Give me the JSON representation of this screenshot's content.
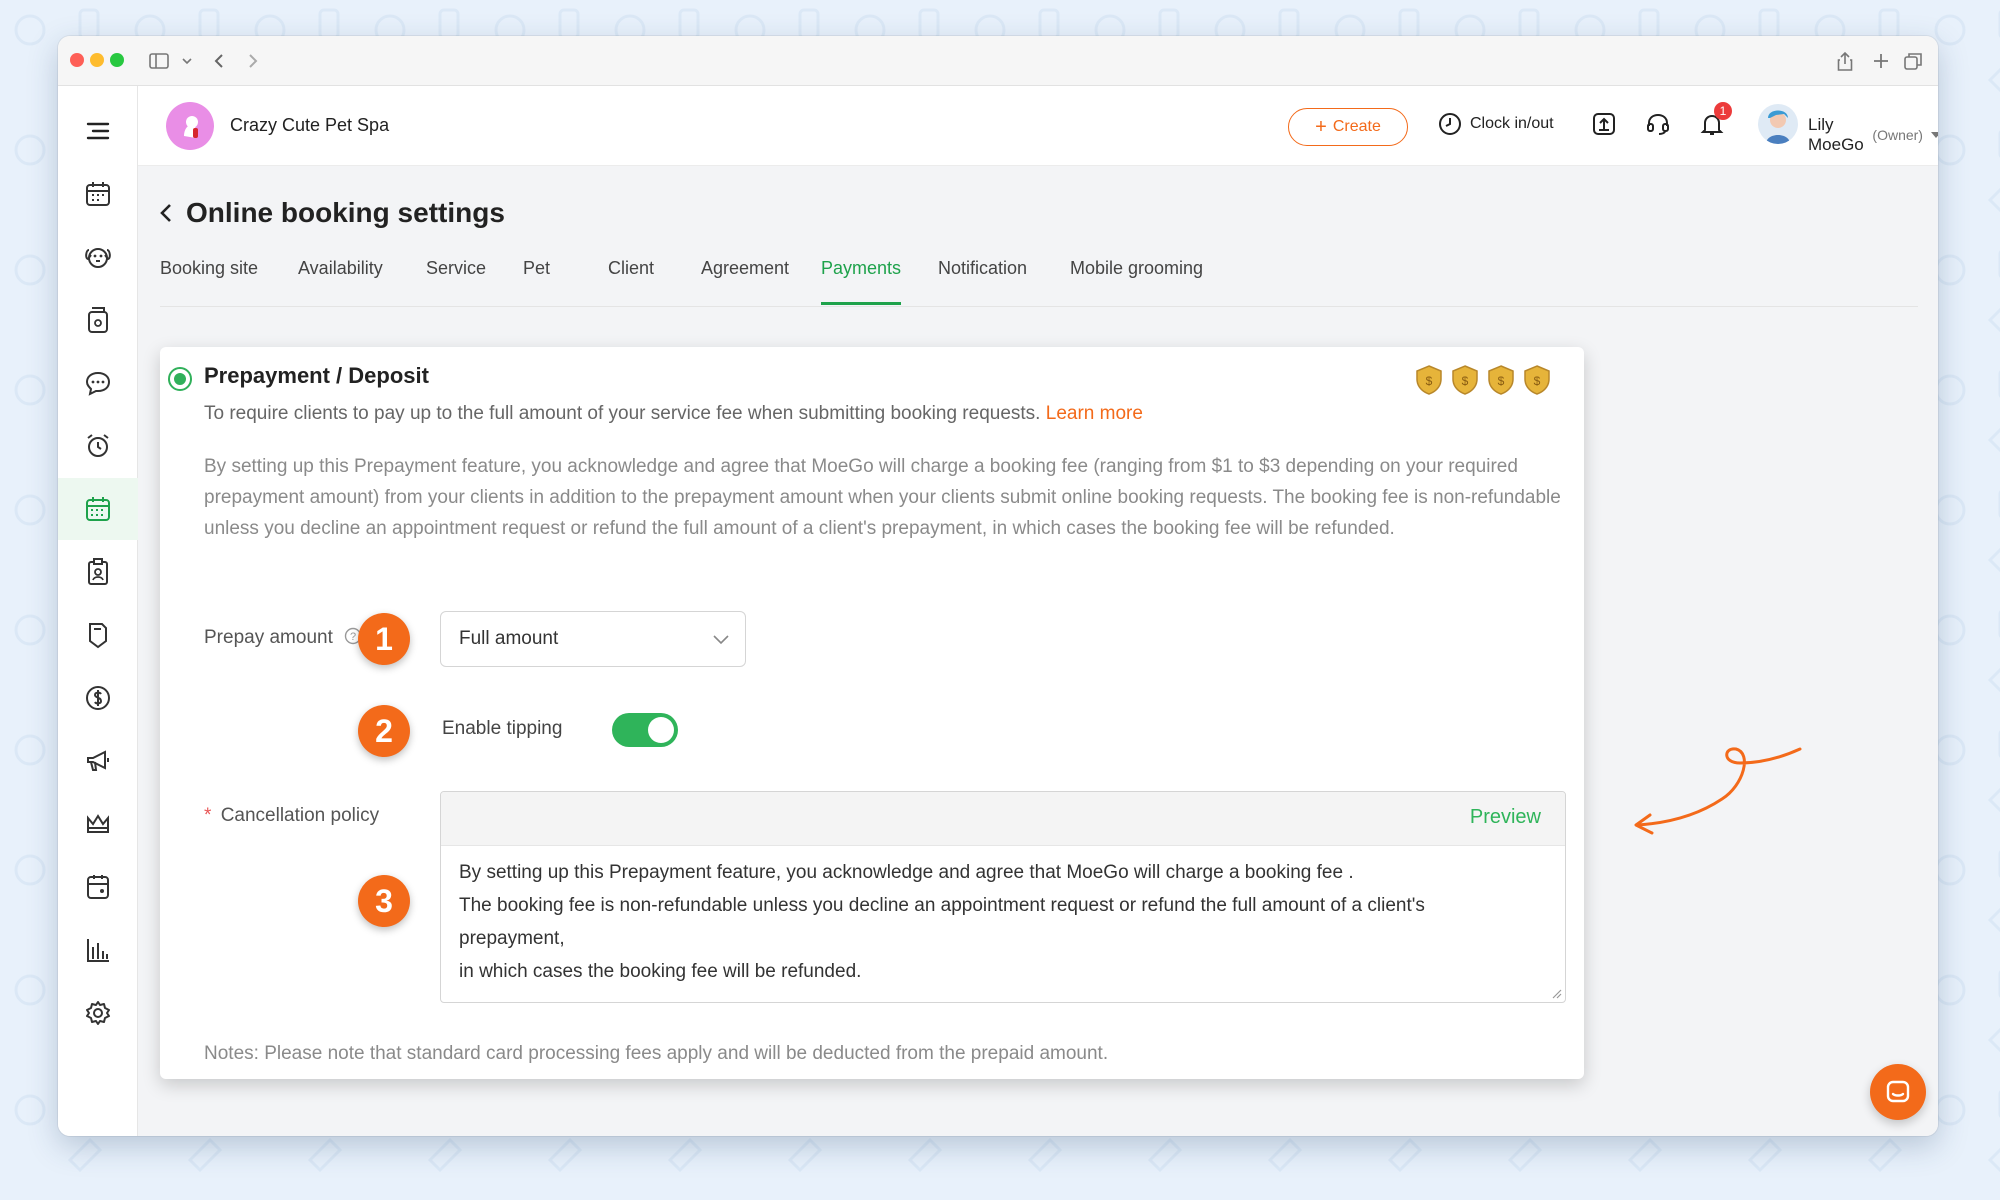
{
  "colors": {
    "accent": "#f36a1a",
    "brand_green": "#1ea24b",
    "text_muted": "#8a8a8a"
  },
  "header": {
    "business_name": "Crazy Cute Pet Spa",
    "create_label": "Create",
    "clock_label": "Clock in/out",
    "notification_count": "1",
    "user_name": "Lily MoeGo",
    "user_role": "(Owner)"
  },
  "sidebar": {
    "items": [
      {
        "icon": "menu-icon"
      },
      {
        "icon": "calendar-icon"
      },
      {
        "icon": "dog-icon"
      },
      {
        "icon": "pet-food-icon"
      },
      {
        "icon": "chat-icon"
      },
      {
        "icon": "alarm-icon"
      },
      {
        "icon": "online-booking-icon",
        "active": true
      },
      {
        "icon": "clipboard-icon"
      },
      {
        "icon": "tag-icon"
      },
      {
        "icon": "dollar-icon"
      },
      {
        "icon": "megaphone-icon"
      },
      {
        "icon": "crown-icon"
      },
      {
        "icon": "calendar-box-icon"
      },
      {
        "icon": "bar-chart-icon"
      },
      {
        "icon": "settings-icon"
      }
    ]
  },
  "page": {
    "title": "Online booking settings",
    "tabs": [
      {
        "label": "Booking site"
      },
      {
        "label": "Availability"
      },
      {
        "label": "Service"
      },
      {
        "label": "Pet"
      },
      {
        "label": "Client"
      },
      {
        "label": "Agreement"
      },
      {
        "label": "Payments",
        "active": true
      },
      {
        "label": "Notification"
      },
      {
        "label": "Mobile grooming"
      }
    ]
  },
  "prepayment": {
    "title": "Prepayment / Deposit",
    "description": "To require clients to pay up to the full amount of your service fee when submitting booking requests.",
    "learn_more": "Learn more",
    "disclaimer": "By setting up this Prepayment feature, you acknowledge and agree that MoeGo will charge a booking fee (ranging from $1 to $3 depending on your required prepayment amount) from your clients in addition to the prepayment amount when your clients submit online booking requests. The booking fee is non-refundable unless you decline an appointment request or refund the full amount of a client's prepayment, in which cases the booking fee will be refunded.",
    "prepay_amount_label": "Prepay amount",
    "prepay_amount_value": "Full amount",
    "enable_tipping_label": "Enable tipping",
    "enable_tipping_on": true,
    "cancellation_label": "Cancellation policy",
    "required_mark": "*",
    "preview_label": "Preview",
    "policy_lines": [
      "By setting up this Prepayment feature, you acknowledge and agree that MoeGo will charge a booking fee .",
      "The booking fee is non-refundable unless you decline an appointment request or refund the full amount of a client's prepayment,",
      "in which cases the booking fee will be refunded."
    ],
    "notes": "Notes: Please note that standard card processing fees apply and will be deducted from the prepaid amount."
  },
  "annotations": {
    "badge_1": "1",
    "badge_2": "2",
    "badge_3": "3"
  }
}
